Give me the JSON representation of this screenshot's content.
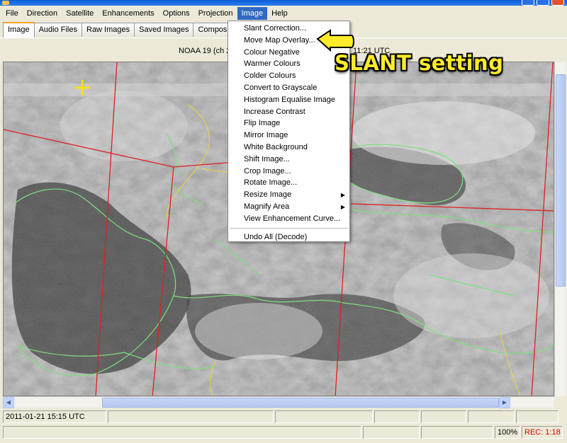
{
  "menubar": {
    "items": [
      "File",
      "Direction",
      "Satellite",
      "Enhancements",
      "Options",
      "Projection",
      "Image",
      "Help"
    ],
    "active": "Image"
  },
  "tabs": [
    "Image",
    "Audio Files",
    "Raw Images",
    "Saved Images",
    "Composite"
  ],
  "info": {
    "satellite": "NOAA 19 (ch 2",
    "time": "11:21 UTC"
  },
  "image_menu": {
    "items": [
      {
        "label": "Slant Correction..."
      },
      {
        "label": "Move Map Overlay..."
      },
      {
        "label": "Colour Negative"
      },
      {
        "label": "Warmer Colours"
      },
      {
        "label": "Colder Colours"
      },
      {
        "label": "Convert to Grayscale"
      },
      {
        "label": "Histogram Equalise Image"
      },
      {
        "label": "Increase Contrast"
      },
      {
        "label": "Flip Image"
      },
      {
        "label": "Mirror Image"
      },
      {
        "label": "White Background"
      },
      {
        "label": "Shift Image..."
      },
      {
        "label": "Crop Image..."
      },
      {
        "label": "Rotate Image..."
      },
      {
        "label": "Resize Image",
        "submenu": true
      },
      {
        "label": "Magnify Area",
        "submenu": true
      },
      {
        "label": "View Enhancement Curve..."
      }
    ],
    "undo": "Undo All (Decode)"
  },
  "annotation": "SLANT setting",
  "status1": {
    "timestamp": "2011-01-21  15:15 UTC"
  },
  "status2": {
    "zoom": "100%",
    "rec": "REC: 1:18"
  },
  "colors": {
    "menu_highlight": "#316ac5",
    "annotation": "#ffeb2a",
    "rec": "#e00000",
    "coastline": "#7de07d",
    "gridline": "#e02020",
    "border": "#e8d24a"
  }
}
